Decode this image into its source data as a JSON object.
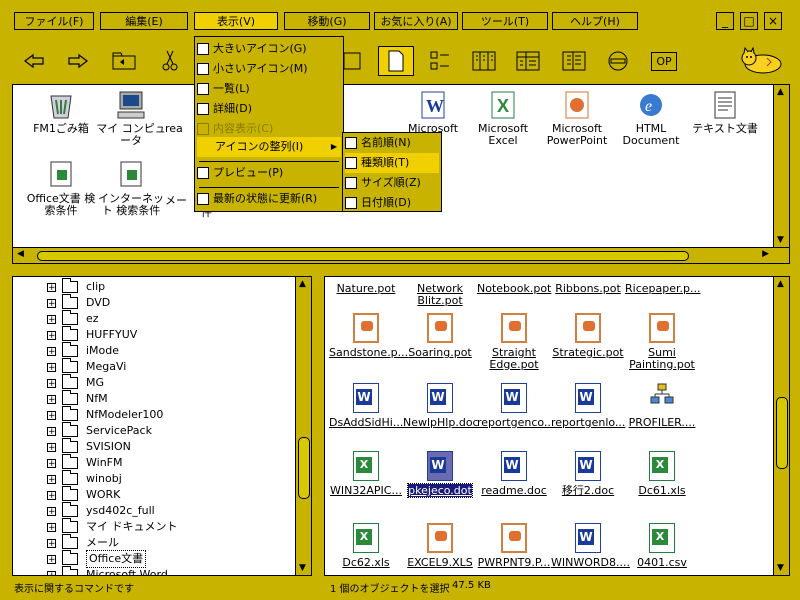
{
  "menubar": {
    "items": [
      "ファイル(F)",
      "編集(E)",
      "表示(V)",
      "移動(G)",
      "お気に入り(A)",
      "ツール(T)",
      "ヘルプ(H)"
    ],
    "window_buttons": [
      "_",
      "□",
      "×"
    ]
  },
  "toolbar": {
    "buttons": [
      "back-arrow-icon",
      "forward-arrow-icon",
      "up-folder-icon",
      "cut-icon",
      "copy-icon",
      "paste-icon",
      "undo-icon",
      "delete-icon",
      "properties-icon",
      "large-icon-view-icon",
      "small-icon-view-icon",
      "list-view-icon",
      "details-view-icon",
      "thumbnails-icon",
      "web-view-icon",
      "no-entry-icon"
    ],
    "op_label": "OP"
  },
  "top_pane": {
    "icons": [
      {
        "label": "FM1ごみ箱",
        "icon": "recycle-bin-icon"
      },
      {
        "label": "マイ コンピュータ",
        "icon": "my-computer-icon"
      },
      {
        "label": "rea",
        "icon": "document-icon"
      },
      {
        "label": "Microsoft",
        "icon": "word-icon"
      },
      {
        "label": "Microsoft Excel",
        "icon": "excel-icon"
      },
      {
        "label": "Microsoft PowerPoint",
        "icon": "powerpoint-icon"
      },
      {
        "label": "HTML Document",
        "icon": "ie-icon"
      },
      {
        "label": "テキスト文書",
        "icon": "text-icon"
      },
      {
        "label": "Office文書 検索条件",
        "icon": "search-criteria-icon"
      },
      {
        "label": "インターネット 検索条件",
        "icon": "search-criteria-icon"
      },
      {
        "label": "メー",
        "icon": "mail-icon"
      },
      {
        "label": "件",
        "icon": "document-icon"
      }
    ]
  },
  "view_menu": {
    "items": [
      {
        "label": "大きいアイコン(G)"
      },
      {
        "label": "小さいアイコン(M)"
      },
      {
        "label": "一覧(L)"
      },
      {
        "label": "詳細(D)"
      },
      {
        "label": "内容表示(C)"
      },
      {
        "label": "アイコンの整列(I)"
      },
      {
        "label": "プレビュー(P)"
      },
      {
        "label": "最新の状態に更新(R)"
      }
    ]
  },
  "arrange_submenu": {
    "items": [
      {
        "label": "名前順(N)"
      },
      {
        "label": "種類順(T)"
      },
      {
        "label": "サイズ順(Z)"
      },
      {
        "label": "日付順(D)"
      }
    ]
  },
  "tree": {
    "items": [
      "clip",
      "DVD",
      "ez",
      "HUFFYUV",
      "iMode",
      "MegaVi",
      "MG",
      "NfM",
      "NfModeler100",
      "ServicePack",
      "SVISION",
      "WinFM",
      "winobj",
      "WORK",
      "ysd402c_full",
      "マイ ドキュメント",
      "メール",
      "Office文書",
      "Microsoft Word"
    ]
  },
  "files": {
    "row0": [
      "Nature.pot",
      "Network Blitz.pot",
      "Notebook.pot",
      "Ribbons.pot",
      "Ricepaper.p..."
    ],
    "row1": [
      "Sandstone.p...",
      "Soaring.pot",
      "Straight Edge.pot",
      "Strategic.pot",
      "Sumi Painting.pot"
    ],
    "row2": [
      "DsAddSidHi...",
      "NewlpHlp.doc",
      "reportgenco...",
      "reportgenlo...",
      "PROFILER...."
    ],
    "row3": [
      "WIN32APIC...",
      "pkejeco.dot",
      "readme.doc",
      "移行2.doc",
      "Dc61.xls"
    ],
    "row4": [
      "Dc62.xls",
      "EXCEL9.XLS",
      "PWRPNT9.P...",
      "WINWORD8....",
      "0401.csv"
    ]
  },
  "status": {
    "left": "表示に関するコマンドです",
    "middle": "1 個のオブジェクトを選択",
    "size": "47.5 KB"
  },
  "colors": {
    "accent": "#c8b400",
    "highlight": "#f0d000"
  }
}
